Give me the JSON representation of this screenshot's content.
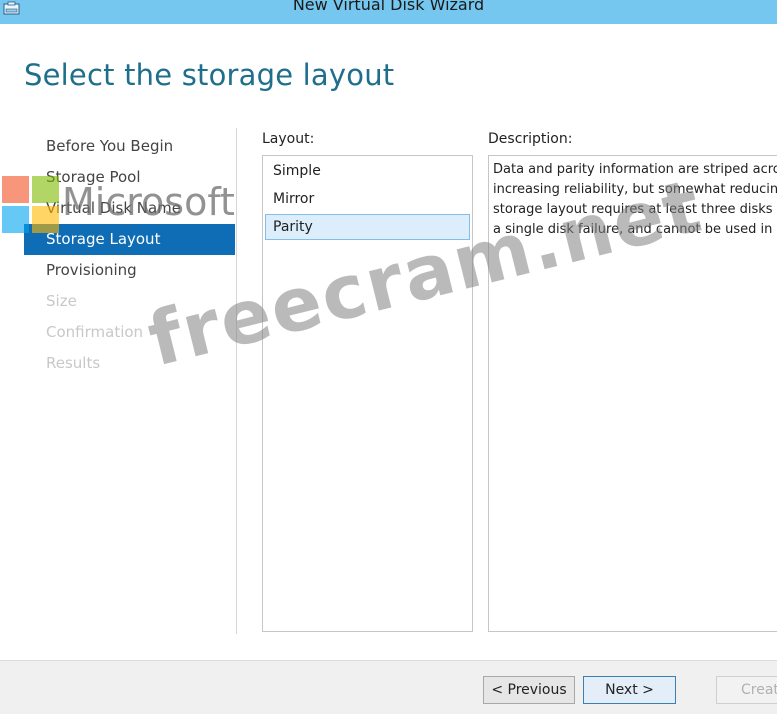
{
  "window": {
    "title": "New Virtual Disk Wizard",
    "icon": "virtual-disk-icon"
  },
  "page": {
    "title": "Select the storage layout"
  },
  "steps": [
    {
      "label": "Before You Begin",
      "state": "normal"
    },
    {
      "label": "Storage Pool",
      "state": "normal"
    },
    {
      "label": "Virtual Disk Name",
      "state": "normal"
    },
    {
      "label": "Storage Layout",
      "state": "active"
    },
    {
      "label": "Provisioning",
      "state": "normal"
    },
    {
      "label": "Size",
      "state": "disabled"
    },
    {
      "label": "Confirmation",
      "state": "disabled"
    },
    {
      "label": "Results",
      "state": "disabled"
    }
  ],
  "layout": {
    "label": "Layout:",
    "options": [
      "Simple",
      "Mirror",
      "Parity"
    ],
    "selected": "Parity"
  },
  "description": {
    "label": "Description:",
    "lines": [
      "Data and parity information are striped acro",
      "increasing reliability, but somewhat reducing",
      "storage layout requires at least three disks t",
      "a single disk failure, and cannot be used in a"
    ]
  },
  "buttons": {
    "previous": "< Previous",
    "next": "Next >",
    "create": "Creat"
  },
  "watermark": {
    "brand": "Microsoft",
    "site": "freecram.net"
  },
  "colors": {
    "titlebar": "#76c7ef",
    "accent": "#0e6db5",
    "title_text": "#1f6f8c"
  }
}
